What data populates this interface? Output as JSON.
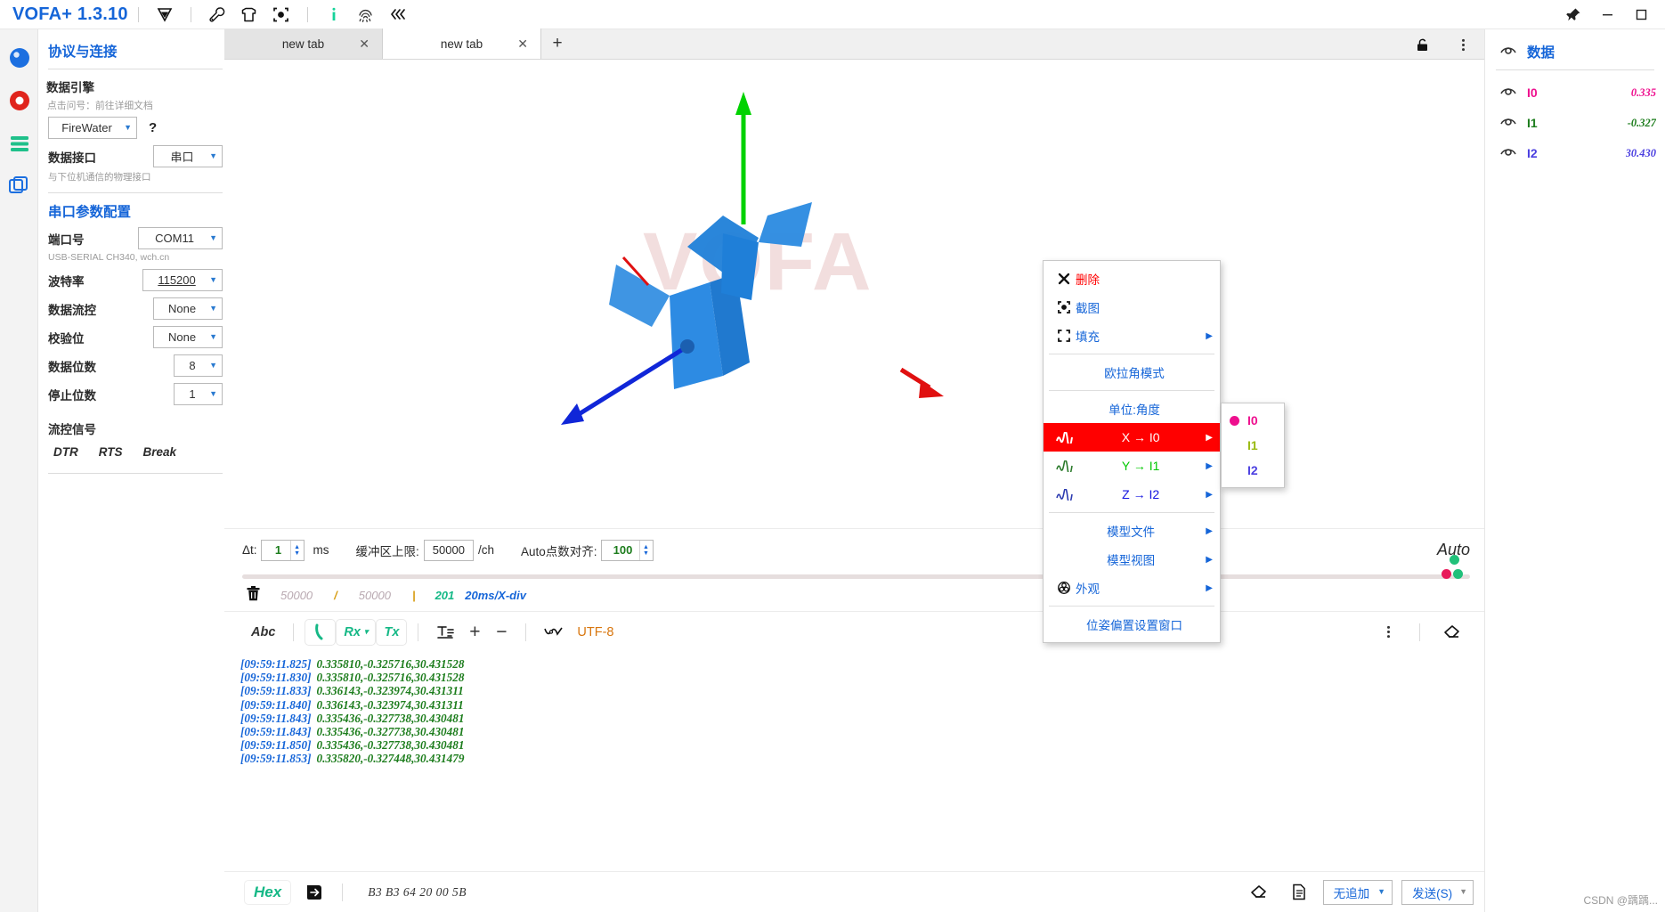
{
  "titlebar": {
    "app_title": "VOFA+ 1.3.10",
    "icons": [
      "vofa-logo-icon",
      "wrench-icon",
      "shirt-icon",
      "target-icon",
      "info-icon",
      "fingerprint-icon",
      "collapse-left-icon"
    ],
    "window_controls": [
      "pin-icon",
      "minimize-icon",
      "maximize-icon"
    ]
  },
  "rail": {
    "items": [
      {
        "name": "circle-blue-icon"
      },
      {
        "name": "record-red-icon"
      },
      {
        "name": "menu-green-icon"
      },
      {
        "name": "layers-blue-icon"
      }
    ]
  },
  "sidebar": {
    "title": "协议与连接",
    "data_engine": {
      "label": "数据引擎",
      "hint": "点击问号：前往详细文档",
      "value": "FireWater",
      "help": "?"
    },
    "data_interface": {
      "label": "数据接口",
      "value": "串口",
      "hint": "与下位机通信的物理接口"
    },
    "serial_section_title": "串口参数配置",
    "fields": [
      {
        "label": "端口号",
        "value": "COM11",
        "sub": "USB-SERIAL CH340, wch.cn",
        "underline": false
      },
      {
        "label": "波特率",
        "value": "115200",
        "sub": "",
        "underline": true
      },
      {
        "label": "数据流控",
        "value": "None",
        "sub": "",
        "underline": false
      },
      {
        "label": "校验位",
        "value": "None",
        "sub": "",
        "underline": false
      },
      {
        "label": "数据位数",
        "value": "8",
        "sub": "",
        "underline": false
      },
      {
        "label": "停止位数",
        "value": "1",
        "sub": "",
        "underline": false
      }
    ],
    "flow_title": "流控信号",
    "flow_buttons": [
      "DTR",
      "RTS",
      "Break"
    ]
  },
  "tabs": {
    "items": [
      {
        "label": "new tab",
        "active": false
      },
      {
        "label": "new tab",
        "active": true
      }
    ],
    "add_label": "+",
    "close_label": "✕",
    "right_icons": [
      "lock-open-icon",
      "more-vertical-icon"
    ]
  },
  "viewport": {
    "watermark": "VOFA",
    "axes": [
      {
        "name": "y-axis-green",
        "color": "#00d200"
      },
      {
        "name": "x-axis-blue",
        "color": "#1565d8"
      },
      {
        "name": "z-axis-red",
        "color": "#e01010"
      }
    ]
  },
  "context_menu": {
    "items": [
      {
        "label": "删除",
        "icon": "close-x-icon",
        "style": "danger",
        "arrow": false
      },
      {
        "label": "截图",
        "icon": "screenshot-icon",
        "style": "normal",
        "arrow": false
      },
      {
        "label": "填充",
        "icon": "fill-expand-icon",
        "style": "normal",
        "arrow": true
      },
      {
        "sep": true
      },
      {
        "label": "欧拉角模式",
        "icon": "",
        "style": "center",
        "arrow": false
      },
      {
        "sep": true
      },
      {
        "label": "单位:角度",
        "icon": "",
        "style": "center",
        "arrow": false
      },
      {
        "label": "X → I0",
        "icon": "wave-icon",
        "style": "axis-selected",
        "arrow": true,
        "color": "#ffffff"
      },
      {
        "label": "Y → I1",
        "icon": "wave-icon",
        "style": "axis",
        "arrow": true,
        "color": "#00c800"
      },
      {
        "label": "Z → I2",
        "icon": "wave-icon",
        "style": "axis",
        "arrow": true,
        "color": "#1515e0"
      },
      {
        "sep": true
      },
      {
        "label": "模型文件",
        "icon": "",
        "style": "center",
        "arrow": true
      },
      {
        "label": "模型视图",
        "icon": "",
        "style": "center",
        "arrow": true
      },
      {
        "label": "外观",
        "icon": "appearance-icon",
        "style": "normal",
        "arrow": true
      },
      {
        "sep": true
      },
      {
        "label": "位姿偏置设置窗口",
        "icon": "",
        "style": "center",
        "arrow": false
      }
    ],
    "submenu": {
      "items": [
        {
          "label": "I0",
          "color": "#ee0f8e",
          "selected": true
        },
        {
          "label": "I1",
          "color": "#9aba12",
          "selected": false
        },
        {
          "label": "I2",
          "color": "#4b3fe0",
          "selected": false
        }
      ]
    }
  },
  "control_bar": {
    "dt_label": "Δt:",
    "dt_value": "1",
    "dt_unit": "ms",
    "buffer_label": "缓冲区上限:",
    "buffer_value": "50000",
    "buffer_unit": "/ch",
    "align_label": "Auto点数对齐:",
    "align_value": "100",
    "auto_label": "Auto"
  },
  "stat_bar": {
    "trash_icon": "trash-icon",
    "current": "50000",
    "slash": "/",
    "total": "50000",
    "divider": "|",
    "points": "201",
    "timebase": "20ms/X-div"
  },
  "terminal": {
    "toolbar": [
      "Abc",
      "phone-icon",
      "Rx",
      "Tx",
      "text-format-icon",
      "+",
      "−",
      "wave-icon",
      "UTF-8"
    ],
    "rx_label": "Rx",
    "tx_label": "Tx",
    "abc_label": "Abc",
    "encoding": "UTF-8",
    "plus_label": "+",
    "minus_label": "−",
    "right_icons": [
      "more-vertical-icon",
      "eraser-icon"
    ],
    "log_lines": [
      {
        "ts": "[09:59:11.825]",
        "value": "0.335810,-0.325716,30.431528"
      },
      {
        "ts": "[09:59:11.830]",
        "value": "0.335810,-0.325716,30.431528"
      },
      {
        "ts": "[09:59:11.833]",
        "value": "0.336143,-0.323974,30.431311"
      },
      {
        "ts": "[09:59:11.840]",
        "value": "0.336143,-0.323974,30.431311"
      },
      {
        "ts": "[09:59:11.843]",
        "value": "0.335436,-0.327738,30.430481"
      },
      {
        "ts": "[09:59:11.843]",
        "value": "0.335436,-0.327738,30.430481"
      },
      {
        "ts": "[09:59:11.850]",
        "value": "0.335436,-0.327738,30.430481"
      },
      {
        "ts": "[09:59:11.853]",
        "value": "0.335820,-0.327448,30.431479"
      }
    ],
    "footer": {
      "hex_label": "Hex",
      "send_icon": "send-arrow-icon",
      "hex_data": "B3 B3 64 20 00 5B",
      "eraser_icon": "eraser-icon",
      "doc_icon": "document-icon",
      "append_mode": "无追加",
      "send_label": "发送(S)"
    }
  },
  "right_panel": {
    "title": "数据",
    "eye_icon": "eye-icon",
    "rows": [
      {
        "name": "I0",
        "value": "0.335",
        "color": "#ee0f8e"
      },
      {
        "name": "I1",
        "value": "-0.327",
        "color": "#1d7d1d"
      },
      {
        "name": "I2",
        "value": "30.430",
        "color": "#4b3fe0"
      }
    ]
  },
  "watermark_br": "CSDN @踽踽..."
}
